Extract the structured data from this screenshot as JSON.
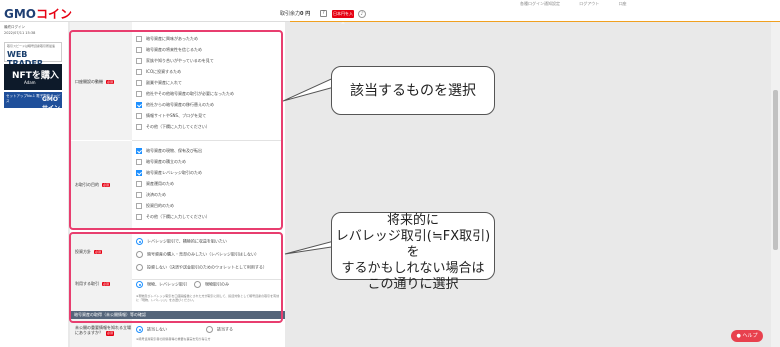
{
  "header": {
    "logo_main": "GMO",
    "logo_accent": "コイン",
    "util_links": [
      "各種ログイン通知設定",
      "ログアウト",
      "口座"
    ],
    "balance_label": "取引余力",
    "balance_value": "0 円",
    "deposit_button": "日本円を入金",
    "bell_icon": "bell-icon"
  },
  "sidebar": {
    "status_line": "最終ログイン",
    "date_line": "2022/07/11 15:38",
    "banner1_top": "取引スピードは暗号資産取引所最速",
    "banner1_main": "WEB TRADER",
    "banner2_main": "NFTを購入",
    "banner2_sub": "Adam",
    "banner3_left": "セットアップNo.1 電子契約サービス",
    "banner3_logo": "GMO サイン"
  },
  "form": {
    "section1": {
      "label": "口座開設の動機",
      "required": "必須",
      "options": [
        {
          "label": "暗号資産に興味があったため",
          "checked": false
        },
        {
          "label": "暗号資産の将来性を信じるため",
          "checked": false
        },
        {
          "label": "家族や知り合いがやっているのを見て",
          "checked": false
        },
        {
          "label": "ICOに投資するため",
          "checked": false
        },
        {
          "label": "副業や資産に入れて",
          "checked": false
        },
        {
          "label": "他社やその他暗号資産の取引が必要になったため",
          "checked": false
        },
        {
          "label": "他社からの暗号資産の移行替えのため",
          "checked": true
        },
        {
          "label": "情報サイトやSNS、ブログを見て",
          "checked": false
        },
        {
          "label": "その他（下欄に入力してください）",
          "checked": false
        }
      ]
    },
    "section2": {
      "label": "お取引の目的",
      "required": "必須",
      "options": [
        {
          "label": "暗号資産の現物、保有及び転出",
          "checked": true
        },
        {
          "label": "暗号資産の積立のため",
          "checked": false
        },
        {
          "label": "暗号資産レバレッジ取引のため",
          "checked": true
        },
        {
          "label": "資産運用のため",
          "checked": false
        },
        {
          "label": "決済のため",
          "checked": false
        },
        {
          "label": "投資目的のため",
          "checked": false
        },
        {
          "label": "その他（下欄に入力してください）",
          "checked": false
        }
      ]
    },
    "section3": {
      "label": "投資方針",
      "required": "必須",
      "options": [
        {
          "label": "レバレッジ取引で、積極的に収益を狙いたい",
          "selected": true
        },
        {
          "label": "暗号資産の購入・売却のみしたい（レバレッジ取引はしない）",
          "selected": false
        },
        {
          "label": "投資しない（決済や送金取引のためのウォレットとして利用する）",
          "selected": false
        }
      ]
    },
    "section4": {
      "label": "利用する取引",
      "required": "必須",
      "options": [
        {
          "label": "現物、レバレッジ取引",
          "selected": true
        },
        {
          "label": "現物取引のみ",
          "selected": false
        }
      ],
      "note": "※現物及びレバレッジ取引を口座開設後にされた方が取引に関して、投資対象として暗号資産の取引を有効に「現物、レバレッジ」をお選びください。"
    },
    "section5_header": "暗号資産の取得（未公開情報）等の確認",
    "section5": {
      "label": "未公開の重要情報を知れる立場にありますか？",
      "required": "必須",
      "options": [
        {
          "label": "該当しない",
          "selected": true
        },
        {
          "label": "該当する",
          "selected": false
        }
      ],
      "note": "※暗号資産取引者の関係者等の重要な事実を知り得る方"
    }
  },
  "callouts": {
    "callout1": "該当するものを選択",
    "callout2_lines": [
      "将来的に",
      "レバレッジ取引(≒FX取引)を",
      "するかもしれない場合は",
      "この通りに選択"
    ]
  },
  "help_button": "ヘルプ",
  "colors": {
    "brand_blue": "#1f3f73",
    "brand_red": "#e60012",
    "highlight_pink": "#e83e6f",
    "check_blue": "#1e90ff"
  }
}
